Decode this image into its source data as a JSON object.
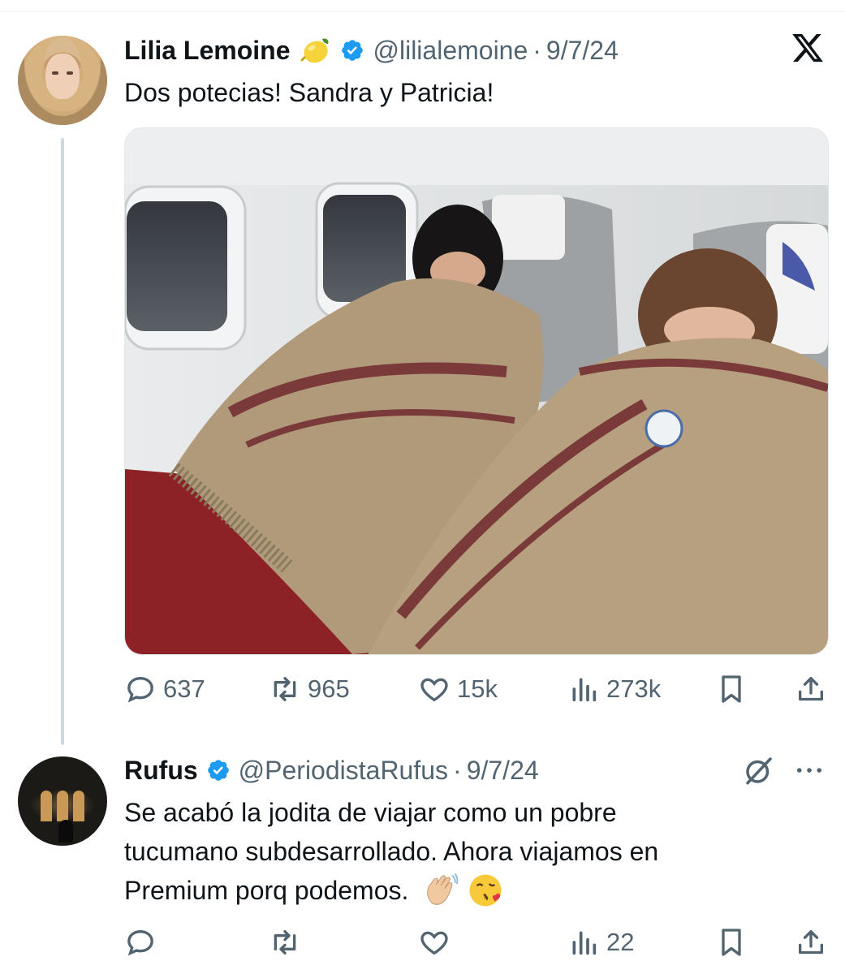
{
  "tweet1": {
    "name": "Lilia Lemoine",
    "handle": "@lilialemoine",
    "date": "9/7/24",
    "text": "Dos potecias! Sandra y Patricia!",
    "name_emoji": "lemon-emoji",
    "metrics": {
      "replies": "637",
      "reposts": "965",
      "likes": "15k",
      "views": "273k"
    }
  },
  "tweet2": {
    "name": "Rufus",
    "handle": "@PeriodistaRufus",
    "date": "9/7/24",
    "text_lines": [
      "Se acabó la jodita de viajar como un pobre",
      "tucumano subdesarrollado. Ahora viajamos en",
      "Premium porq podemos."
    ],
    "emojis": [
      "waving-hand-emoji",
      "face-blowing-kiss-emoji"
    ],
    "metrics": {
      "replies": "",
      "reposts": "",
      "likes": "",
      "views": "22"
    }
  },
  "separator": "·",
  "colors": {
    "verified": "#1d9bf0",
    "text": "#0f1419",
    "secondary": "#536471",
    "thread_line": "#cfd9de"
  },
  "icons": [
    "x-logo-icon",
    "verified-badge-icon",
    "reply-icon",
    "repost-icon",
    "like-icon",
    "views-icon",
    "bookmark-icon",
    "share-icon",
    "grok-icon",
    "more-icon"
  ]
}
